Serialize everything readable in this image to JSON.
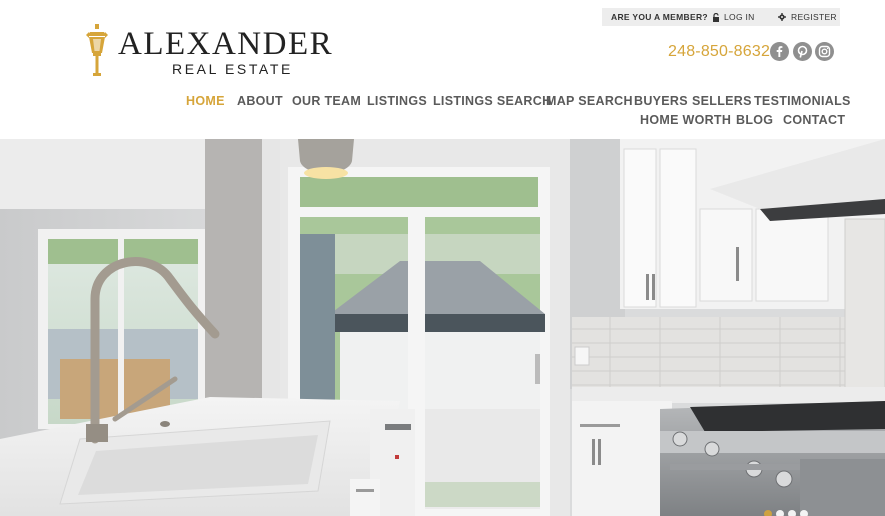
{
  "brand": {
    "name": "ALEXANDER",
    "subtitle": "REAL ESTATE"
  },
  "member_bar": {
    "question": "ARE YOU A MEMBER?",
    "login_label": "LOG IN",
    "register_label": "REGISTER"
  },
  "contact": {
    "phone": "248-850-8632"
  },
  "social": [
    {
      "icon": "facebook-icon",
      "glyph": "f"
    },
    {
      "icon": "pinterest-icon",
      "glyph": "p"
    },
    {
      "icon": "instagram-icon",
      "glyph": "ig"
    }
  ],
  "nav": {
    "row1": [
      "HOME",
      "ABOUT",
      "OUR TEAM",
      "LISTINGS",
      "LISTINGS SEARCH",
      "MAP SEARCH",
      "BUYERS",
      "SELLERS",
      "TESTIMONIALS"
    ],
    "row2": [
      "HOME WORTH",
      "BLOG",
      "CONTACT"
    ],
    "active": "HOME"
  },
  "hero": {
    "description": "kitchen-photo",
    "slides": 4,
    "active_slide": 1
  },
  "colors": {
    "accent": "#d6a53a",
    "nav_text": "#5a5a5a",
    "social_bg": "#8f8f8f",
    "member_bar_bg": "#ededed"
  }
}
